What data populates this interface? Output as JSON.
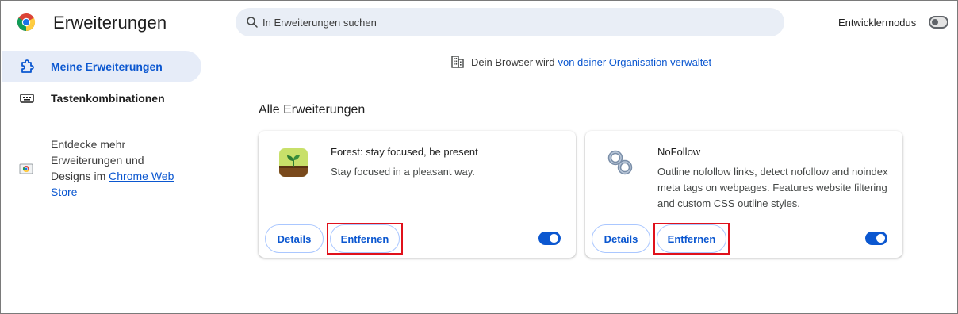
{
  "header": {
    "title": "Erweiterungen",
    "search_placeholder": "In Erweiterungen suchen",
    "developer_mode_label": "Entwicklermodus",
    "developer_mode_on": false
  },
  "sidebar": {
    "items": [
      {
        "label": "Meine Erweiterungen",
        "icon": "puzzle-icon",
        "active": true
      },
      {
        "label": "Tastenkombinationen",
        "icon": "keyboard-icon",
        "active": false
      }
    ],
    "discover_text": "Entdecke mehr Erweiterungen und Designs im",
    "discover_link": "Chrome Web Store"
  },
  "notice": {
    "text": "Dein Browser wird",
    "link": "von deiner Organisation verwaltet",
    "icon": "building-icon"
  },
  "main": {
    "section_title": "Alle Erweiterungen",
    "extensions": [
      {
        "name": "Forest: stay focused, be present",
        "description": "Stay focused in a pleasant way.",
        "icon": "forest-icon",
        "details_label": "Details",
        "remove_label": "Entfernen",
        "enabled": true
      },
      {
        "name": "NoFollow",
        "description": "Outline nofollow links, detect nofollow and noindex meta tags on webpages. Features website filtering and custom CSS outline styles.",
        "icon": "chain-link-icon",
        "details_label": "Details",
        "remove_label": "Entfernen",
        "enabled": true
      }
    ]
  },
  "colors": {
    "accent": "#0b57d0",
    "highlight_box": "#e0111b",
    "search_bg": "#e9eef6",
    "active_nav_bg": "#e6ecf8"
  }
}
